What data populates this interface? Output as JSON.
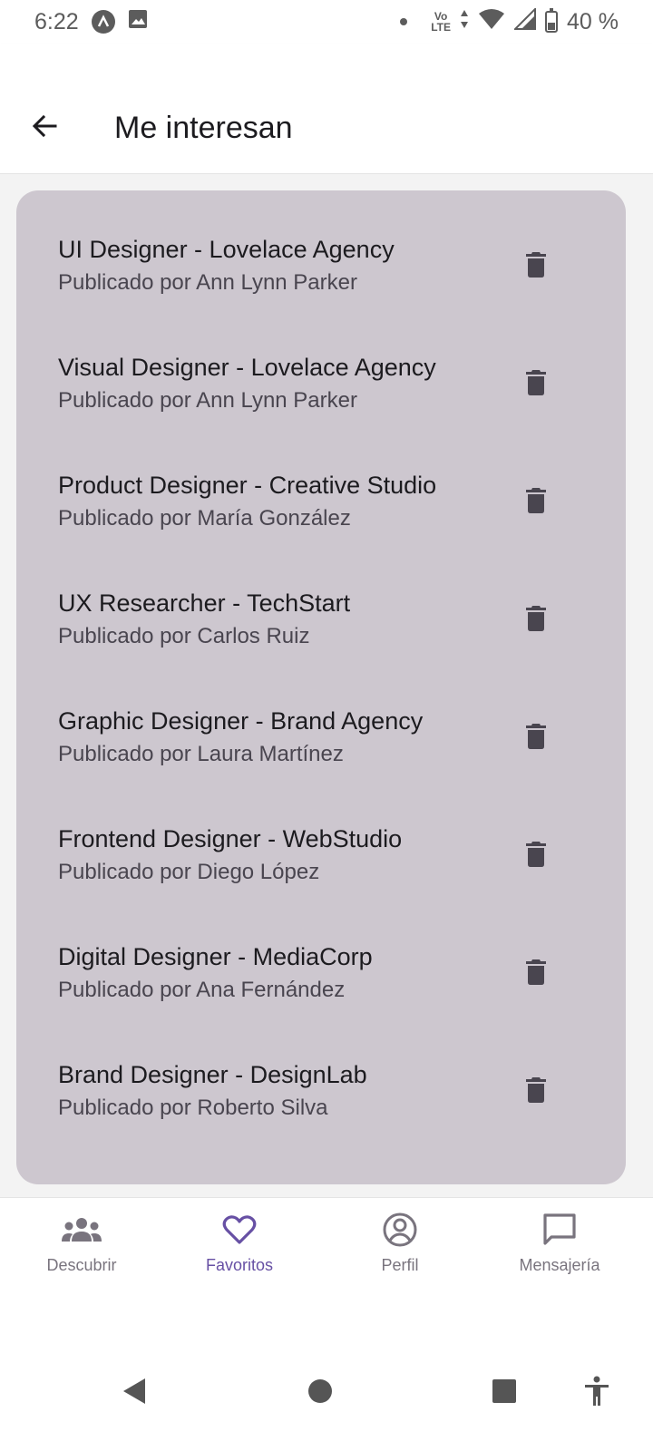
{
  "status_bar": {
    "time": "6:22",
    "volte_line1": "Vo",
    "volte_line2": "LTE",
    "battery": "40 %"
  },
  "header": {
    "title": "Me interesan",
    "back_icon": "arrow-back-icon"
  },
  "favorites": [
    {
      "title": "UI Designer - Lovelace Agency",
      "subtitle": "Publicado por Ann Lynn Parker"
    },
    {
      "title": "Visual Designer - Lovelace Agency",
      "subtitle": "Publicado por Ann Lynn Parker"
    },
    {
      "title": "Product Designer - Creative Studio",
      "subtitle": "Publicado por María González"
    },
    {
      "title": "UX Researcher - TechStart",
      "subtitle": "Publicado por Carlos Ruiz"
    },
    {
      "title": "Graphic Designer - Brand Agency",
      "subtitle": "Publicado por Laura Martínez"
    },
    {
      "title": "Frontend Designer - WebStudio",
      "subtitle": "Publicado por Diego López"
    },
    {
      "title": "Digital Designer - MediaCorp",
      "subtitle": "Publicado por Ana Fernández"
    },
    {
      "title": "Brand Designer - DesignLab",
      "subtitle": "Publicado por Roberto Silva"
    }
  ],
  "bottom_nav": [
    {
      "label": "Descubrir",
      "icon": "people-icon",
      "active": false
    },
    {
      "label": "Favoritos",
      "icon": "heart-icon",
      "active": true
    },
    {
      "label": "Perfil",
      "icon": "account-circle-icon",
      "active": false
    },
    {
      "label": "Mensajería",
      "icon": "chat-icon",
      "active": false
    }
  ],
  "colors": {
    "accent": "#6750a4",
    "card_background": "#cdc7cf",
    "inactive_nav": "#79747e"
  }
}
